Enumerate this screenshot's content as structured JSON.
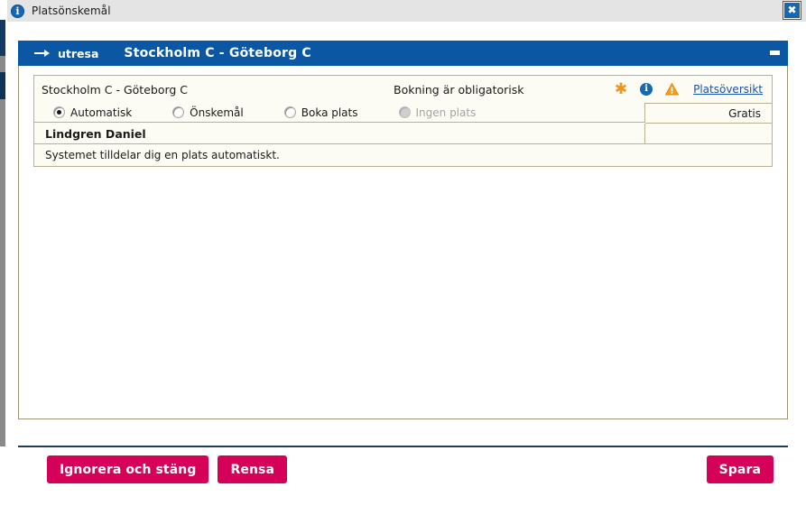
{
  "window": {
    "title": "Platsönskemål",
    "info_icon": "info-circle-icon",
    "close_label": "✖"
  },
  "section_header": {
    "direction_icon": "arrow-right-icon",
    "direction_label": "utresa",
    "route": "Stockholm C - Göteborg C",
    "minimize_label": "minimize-icon"
  },
  "booking_card": {
    "route": "Stockholm C - Göteborg C",
    "mandatory_text": "Bokning är obligatorisk",
    "icons": {
      "asterisk": "✱",
      "info": "i",
      "warning": "warning-triangle-icon"
    },
    "overview_link": "Platsöversikt",
    "options": [
      {
        "label": "Automatisk",
        "selected": true,
        "disabled": false
      },
      {
        "label": "Önskemål",
        "selected": false,
        "disabled": false
      },
      {
        "label": "Boka plats",
        "selected": false,
        "disabled": false
      },
      {
        "label": "Ingen plats",
        "selected": false,
        "disabled": true
      }
    ],
    "price": "Gratis",
    "passenger": "Lindgren Daniel",
    "note": "Systemet tilldelar dig en plats automatiskt."
  },
  "footer": {
    "ignore_close": "Ignorera och stäng",
    "clear": "Rensa",
    "save": "Spara"
  },
  "colors": {
    "header_blue": "#0b57a4",
    "accent_magenta": "#d50057",
    "link_blue": "#1a53a8",
    "warning_orange": "#f0931e",
    "card_cream": "#fdfcf4",
    "card_border": "#b9b190"
  }
}
